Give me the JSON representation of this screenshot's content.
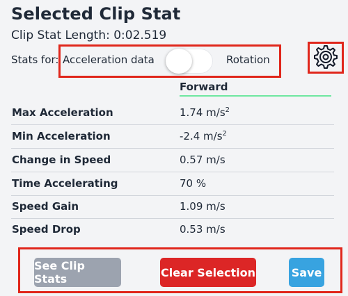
{
  "header": {
    "title": "Selected Clip Stat",
    "clip_length": "Clip Stat Length: 0:02.519"
  },
  "stats_for": {
    "label": "Stats for:",
    "left_option": "Acceleration data",
    "right_option": "Rotation",
    "toggle_state": "left"
  },
  "settings": {
    "icon": "gear-icon"
  },
  "table": {
    "column_header": "Forward",
    "rows": [
      {
        "label": "Max Acceleration",
        "value": "1.74 m/s",
        "sup": "2"
      },
      {
        "label": "Min Acceleration",
        "value": "-2.4 m/s",
        "sup": "2"
      },
      {
        "label": "Change in Speed",
        "value": "0.57 m/s"
      },
      {
        "label": "Time Accelerating",
        "value": "70 %"
      },
      {
        "label": "Speed Gain",
        "value": "1.09 m/s"
      },
      {
        "label": "Speed Drop",
        "value": "0.53 m/s"
      }
    ]
  },
  "buttons": {
    "see_clip_stats": "See Clip Stats",
    "clear_selection": "Clear Selection",
    "save": "Save"
  },
  "colors": {
    "highlight_border": "#e0261b",
    "column_underline": "#6ee7a0",
    "see_clip_stats_bg": "#9ca3af",
    "clear_selection_bg": "#dc2626",
    "save_bg": "#38a3e0"
  }
}
